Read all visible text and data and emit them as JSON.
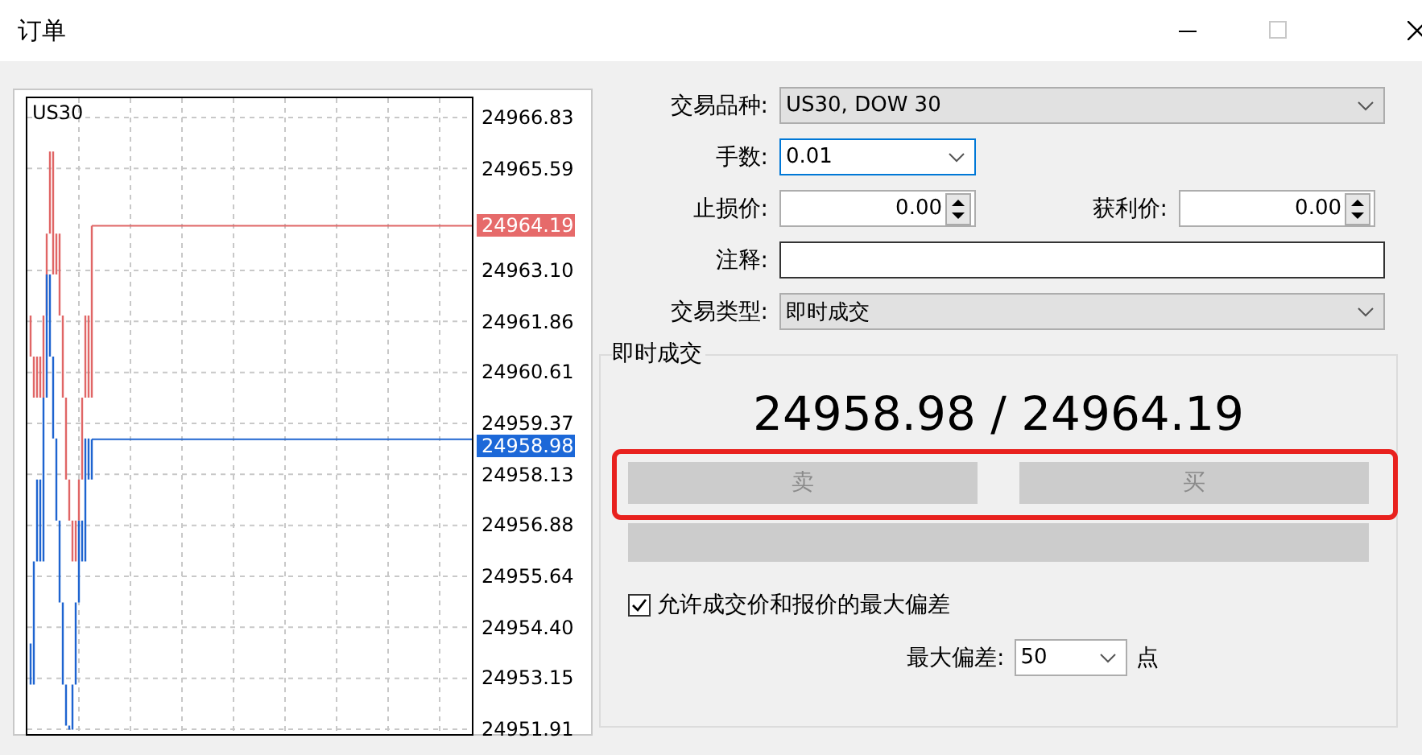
{
  "window": {
    "title": "订单"
  },
  "chart": {
    "symbol": "US30",
    "price_axis": [
      "24966.83",
      "24965.59",
      "24963.10",
      "24961.86",
      "24960.61",
      "24959.37",
      "24958.13",
      "24956.88",
      "24955.64",
      "24954.40",
      "24953.15",
      "24951.91"
    ],
    "bid_tag": "24958.98",
    "ask_tag": "24964.19"
  },
  "form": {
    "symbol": {
      "label": "交易品种:",
      "value": "US30, DOW 30"
    },
    "volume": {
      "label": "手数:",
      "value": "0.01"
    },
    "stop_loss": {
      "label": "止损价:",
      "value": "0.00"
    },
    "take_profit": {
      "label": "获利价:",
      "value": "0.00"
    },
    "comment": {
      "label": "注释:"
    },
    "order_type": {
      "label": "交易类型:",
      "value": "即时成交"
    }
  },
  "execution": {
    "title": "即时成交",
    "quote": "24958.98 / 24964.19",
    "buttons": [
      {
        "label": "卖",
        "disabled": true
      },
      {
        "label": "买",
        "disabled": true
      }
    ],
    "deviation_check": {
      "label": "允许成交价和报价的最大偏差",
      "checked": true
    },
    "max_deviation": {
      "label": "最大偏差:",
      "value": "50",
      "unit": "点"
    }
  }
}
